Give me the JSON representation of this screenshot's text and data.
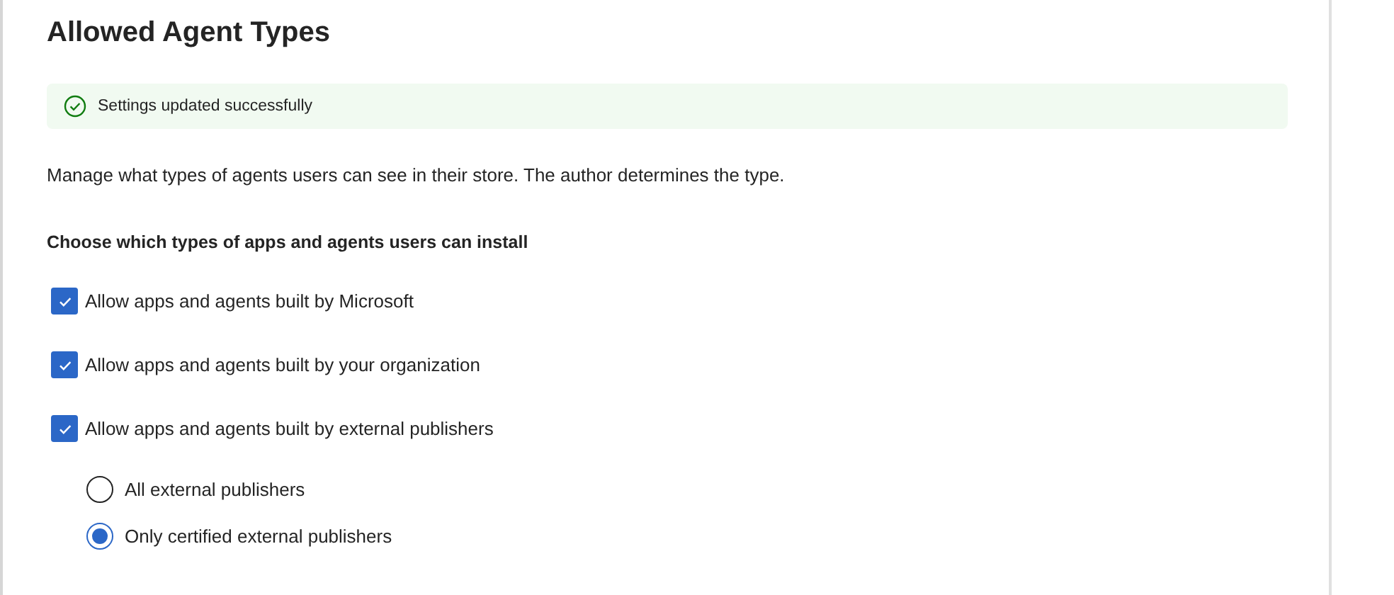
{
  "title": "Allowed Agent Types",
  "banner": {
    "kind": "success",
    "message": "Settings updated successfully"
  },
  "description": "Manage what types of agents users can see in their store. The author determines the type.",
  "section_heading": "Choose which types of apps and agents users can install",
  "checkboxes": [
    {
      "label": "Allow apps and agents built by Microsoft",
      "checked": true
    },
    {
      "label": "Allow apps and agents built by your organization",
      "checked": true
    },
    {
      "label": "Allow apps and agents built by external publishers",
      "checked": true
    }
  ],
  "publisher_options": [
    {
      "label": "All external publishers",
      "selected": false
    },
    {
      "label": "Only certified external publishers",
      "selected": true
    }
  ]
}
